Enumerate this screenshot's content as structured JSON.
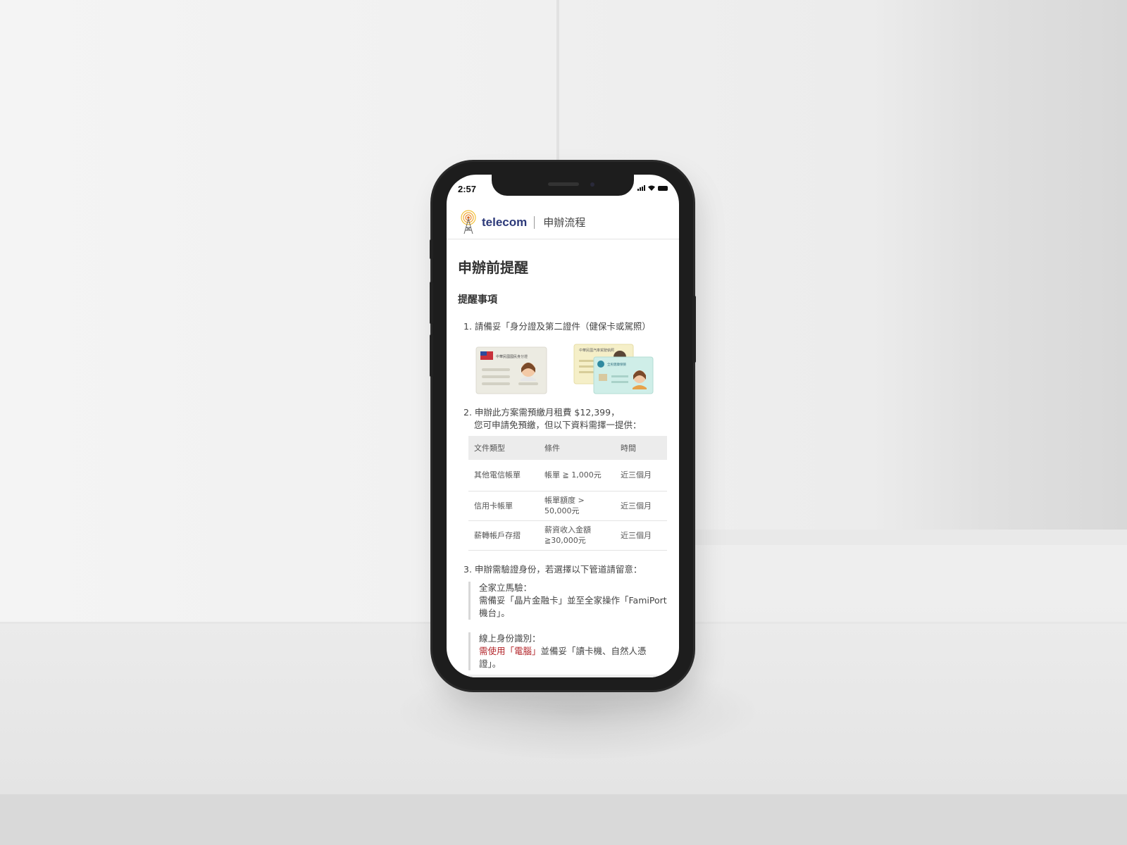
{
  "status_bar": {
    "time": "2:57"
  },
  "header": {
    "brand": "telecom",
    "title": "申辦流程"
  },
  "page": {
    "title": "申辦前提醒",
    "section_title": "提醒事項",
    "item1": {
      "text": "1. 請備妥「身分證及第二證件（健保卡或駕照）",
      "card1_caption": "中華民國國民身分證",
      "card2_caption": "中華民國汽車駕駛執照",
      "card3_caption": "全民健康保險"
    },
    "item2": {
      "line1": "2. 申辦此方案需預繳月租費 $12,399，",
      "line2": "您可申請免預繳，但以下資料需擇一提供："
    },
    "table": {
      "headers": [
        "文件類型",
        "條件",
        "時間"
      ],
      "rows": [
        [
          "其他電信帳單",
          "帳單 ≧ 1,000元",
          "近三個月"
        ],
        [
          "信用卡帳單",
          "帳單額度 > 50,000元",
          "近三個月"
        ],
        [
          "薪轉帳戶存摺",
          "薪資收入金額 ≧30,000元",
          "近三個月"
        ]
      ]
    },
    "item3": {
      "text": "3. 申辦需驗證身份，若選擇以下管道請留意：",
      "quote1_title": "全家立馬驗：",
      "quote1_body": "需備妥「晶片金融卡」並至全家操作「FamiPort機台」。",
      "quote2_title": "線上身份識別：",
      "quote2_red": "需使用「電腦」",
      "quote2_body": "並備妥「讀卡機、自然人憑證」。"
    }
  },
  "colors": {
    "brand": "#2d3a7a",
    "warning": "#b3262b",
    "table_header_bg": "#ececec"
  }
}
